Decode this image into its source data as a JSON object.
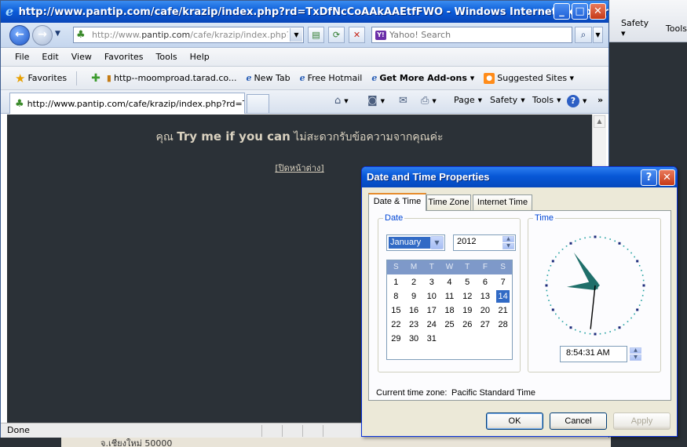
{
  "background": {
    "toolbar_items": [
      "Safety ▾",
      "Tools"
    ],
    "bottom_text": "จ.เชียงใหม่ 50000"
  },
  "browser": {
    "title": "http://www.pantip.com/cafe/krazip/index.php?rd=TxDfNcCoAAkAAEtfFWO - Windows Internet Explorer",
    "address": {
      "prefix": "http://www.",
      "domain": "pantip.com",
      "path": "/cafe/krazip/index.php?rd=T"
    },
    "search_placeholder": "Yahoo! Search",
    "menu": [
      "File",
      "Edit",
      "View",
      "Favorites",
      "Tools",
      "Help"
    ],
    "favorites_label": "Favorites",
    "favorites_links": [
      {
        "label": "http--moomproad.tarad.co...",
        "icon": "page-icon"
      },
      {
        "label": "New Tab",
        "icon": "ie-icon"
      },
      {
        "label": "Free Hotmail",
        "icon": "ie-icon"
      },
      {
        "label": "Get More Add-ons ▾",
        "icon": "ie-icon"
      },
      {
        "label": "Suggested Sites ▾",
        "icon": "suggested-sites-icon"
      }
    ],
    "tab_label": "http://www.pantip.com/cafe/krazip/index.php?rd=Tx...",
    "commands": {
      "page": "Page",
      "safety": "Safety",
      "tools": "Tools"
    },
    "status": "Done"
  },
  "page_content": {
    "title_prefix": "คุณ",
    "title_name": "Try me if you can",
    "title_suffix": "ไม่สะดวกรับข้อความจากคุณค่ะ",
    "close_link": "[ปิดหน้าต่าง]"
  },
  "dialog": {
    "title": "Date and Time Properties",
    "tabs": [
      "Date & Time",
      "Time Zone",
      "Internet Time"
    ],
    "active_tab": "Date & Time",
    "date_group_label": "Date",
    "time_group_label": "Time",
    "month": "January",
    "year": "2012",
    "weekdays": [
      "S",
      "M",
      "T",
      "W",
      "T",
      "F",
      "S"
    ],
    "calendar_weeks": [
      [
        "1",
        "2",
        "3",
        "4",
        "5",
        "6",
        "7"
      ],
      [
        "8",
        "9",
        "10",
        "11",
        "12",
        "13",
        "14"
      ],
      [
        "15",
        "16",
        "17",
        "18",
        "19",
        "20",
        "21"
      ],
      [
        "22",
        "23",
        "24",
        "25",
        "26",
        "27",
        "28"
      ],
      [
        "29",
        "30",
        "31",
        "",
        "",
        "",
        ""
      ]
    ],
    "selected_day": "14",
    "time": "8:54:31 AM",
    "clock": {
      "hour": 8,
      "minute": 54,
      "second": 31
    },
    "timezone_label": "Current time zone:",
    "timezone_value": "Pacific Standard Time",
    "buttons": {
      "ok": "OK",
      "cancel": "Cancel",
      "apply": "Apply"
    },
    "colors": {
      "accent": "#316ac5",
      "clock_hands": "#1f6f6a",
      "titlebar": "#0757d6"
    }
  }
}
